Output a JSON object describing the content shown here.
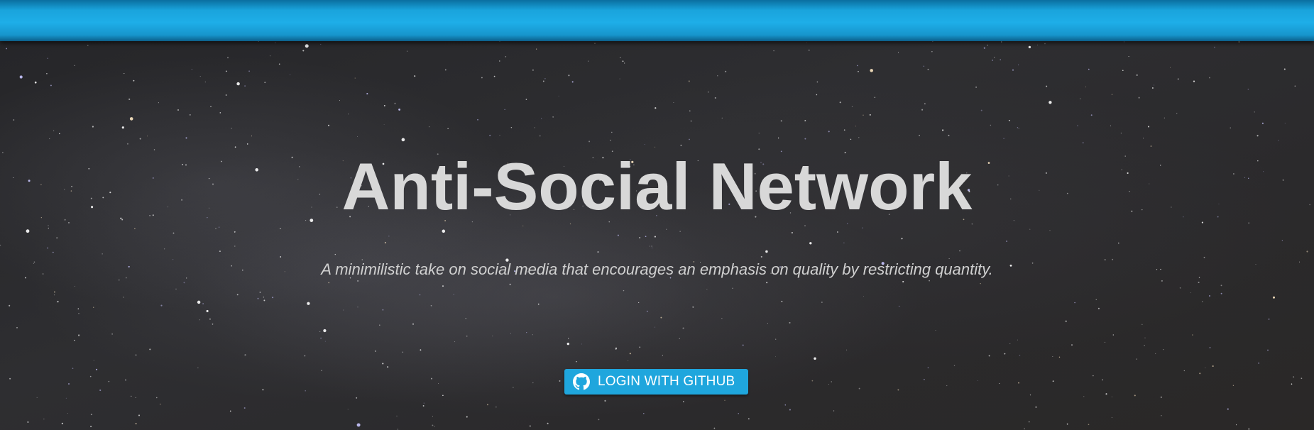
{
  "header": {
    "bar_color": "#1eaee8"
  },
  "hero": {
    "title": "Anti-Social Network",
    "subtitle": "A minimilistic take on social media that encourages an emphasis on quality by restricting quantity.",
    "background": "starry-night-sky"
  },
  "login": {
    "label": "LOGIN WITH GITHUB",
    "icon": "github-icon",
    "color": "#1fa6dd"
  }
}
